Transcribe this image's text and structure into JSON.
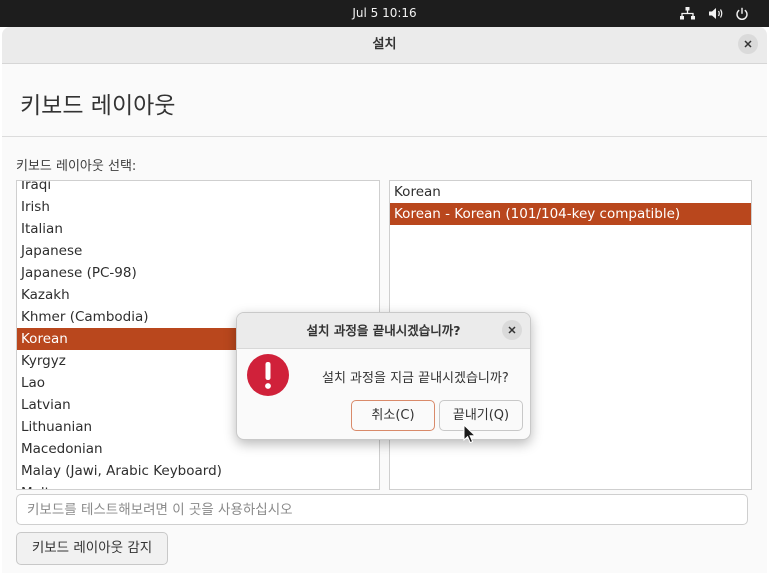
{
  "topbar": {
    "clock": "Jul 5  10:16"
  },
  "window": {
    "title": "설치",
    "heading": "키보드 레이아웃",
    "layout_label": "키보드 레이아웃 선택:",
    "layouts": [
      "Iraqi",
      "Irish",
      "Italian",
      "Japanese",
      "Japanese (PC-98)",
      "Kazakh",
      "Khmer (Cambodia)",
      "Korean",
      "Kyrgyz",
      "Lao",
      "Latvian",
      "Lithuanian",
      "Macedonian",
      "Malay (Jawi, Arabic Keyboard)",
      "Maltese"
    ],
    "selected_layout": "Korean",
    "variants": [
      "Korean",
      "Korean - Korean (101/104-key compatible)"
    ],
    "selected_variant": "Korean - Korean (101/104-key compatible)",
    "test_placeholder": "키보드를 테스트해보려면 이 곳을 사용하십시오",
    "detect_button": "키보드 레이아웃 감지"
  },
  "dialog": {
    "title": "설치 과정을 끝내시겠습니까?",
    "message": "설치 과정을 지금 끝내시겠습니까?",
    "cancel": "취소(C)",
    "quit": "끝내기(Q)"
  },
  "colors": {
    "accent": "#b9471d",
    "error": "#d0213a",
    "panel": "#1d1d1d"
  }
}
